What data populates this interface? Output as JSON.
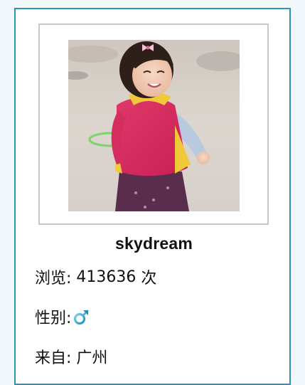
{
  "profile": {
    "username": "skydream",
    "views_label": "浏览:",
    "views_count": "413636",
    "views_unit": "次",
    "gender_label": "性别:",
    "gender_icon": "male-symbol-icon",
    "from_label": "来自:",
    "from_value": "广州"
  },
  "colors": {
    "card_border": "#2e93b8",
    "page_background": "#f2f8fc",
    "male_icon": "#3aa6cf"
  }
}
